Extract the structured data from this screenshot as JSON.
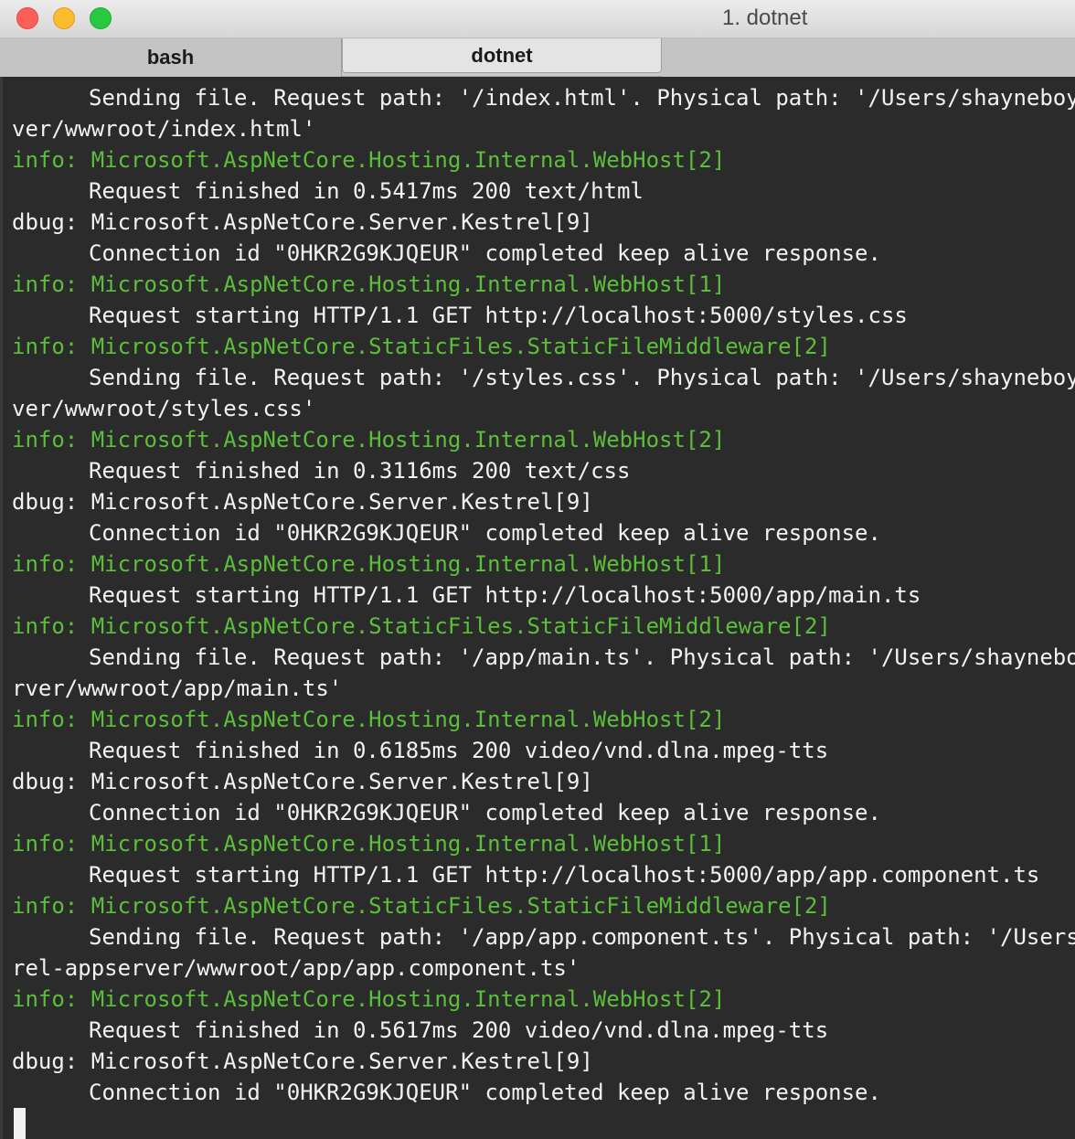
{
  "window": {
    "title": "1. dotnet"
  },
  "tabs": [
    {
      "label": "bash",
      "active": false
    },
    {
      "label": "dotnet",
      "active": true
    }
  ],
  "colors": {
    "background": "#2b2b2b",
    "text": "#f2f2f2",
    "info_green": "#5bbf3a"
  },
  "terminal": {
    "lines": [
      {
        "kind": "cont",
        "text": "Sending file. Request path: '/index.html'. Physical path: '/Users/shayneboyer/"
      },
      {
        "kind": "wrap",
        "text": "ver/wwwroot/index.html'"
      },
      {
        "kind": "log",
        "level": "info:",
        "category": "Microsoft.AspNetCore.Hosting.Internal.WebHost[2]"
      },
      {
        "kind": "cont",
        "text": "Request finished in 0.5417ms 200 text/html"
      },
      {
        "kind": "log",
        "level": "dbug:",
        "category": "Microsoft.AspNetCore.Server.Kestrel[9]"
      },
      {
        "kind": "cont",
        "text": "Connection id \"0HKR2G9KJQEUR\" completed keep alive response."
      },
      {
        "kind": "log",
        "level": "info:",
        "category": "Microsoft.AspNetCore.Hosting.Internal.WebHost[1]"
      },
      {
        "kind": "cont",
        "text": "Request starting HTTP/1.1 GET http://localhost:5000/styles.css"
      },
      {
        "kind": "log",
        "level": "info:",
        "category": "Microsoft.AspNetCore.StaticFiles.StaticFileMiddleware[2]"
      },
      {
        "kind": "cont",
        "text": "Sending file. Request path: '/styles.css'. Physical path: '/Users/shayneboyer/"
      },
      {
        "kind": "wrap",
        "text": "ver/wwwroot/styles.css'"
      },
      {
        "kind": "log",
        "level": "info:",
        "category": "Microsoft.AspNetCore.Hosting.Internal.WebHost[2]"
      },
      {
        "kind": "cont",
        "text": "Request finished in 0.3116ms 200 text/css"
      },
      {
        "kind": "log",
        "level": "dbug:",
        "category": "Microsoft.AspNetCore.Server.Kestrel[9]"
      },
      {
        "kind": "cont",
        "text": "Connection id \"0HKR2G9KJQEUR\" completed keep alive response."
      },
      {
        "kind": "log",
        "level": "info:",
        "category": "Microsoft.AspNetCore.Hosting.Internal.WebHost[1]"
      },
      {
        "kind": "cont",
        "text": "Request starting HTTP/1.1 GET http://localhost:5000/app/main.ts"
      },
      {
        "kind": "log",
        "level": "info:",
        "category": "Microsoft.AspNetCore.StaticFiles.StaticFileMiddleware[2]"
      },
      {
        "kind": "cont",
        "text": "Sending file. Request path: '/app/main.ts'. Physical path: '/Users/shayneboye"
      },
      {
        "kind": "wrap",
        "text": "rver/wwwroot/app/main.ts'"
      },
      {
        "kind": "log",
        "level": "info:",
        "category": "Microsoft.AspNetCore.Hosting.Internal.WebHost[2]"
      },
      {
        "kind": "cont",
        "text": "Request finished in 0.6185ms 200 video/vnd.dlna.mpeg-tts"
      },
      {
        "kind": "log",
        "level": "dbug:",
        "category": "Microsoft.AspNetCore.Server.Kestrel[9]"
      },
      {
        "kind": "cont",
        "text": "Connection id \"0HKR2G9KJQEUR\" completed keep alive response."
      },
      {
        "kind": "log",
        "level": "info:",
        "category": "Microsoft.AspNetCore.Hosting.Internal.WebHost[1]"
      },
      {
        "kind": "cont",
        "text": "Request starting HTTP/1.1 GET http://localhost:5000/app/app.component.ts"
      },
      {
        "kind": "log",
        "level": "info:",
        "category": "Microsoft.AspNetCore.StaticFiles.StaticFileMiddleware[2]"
      },
      {
        "kind": "cont",
        "text": "Sending file. Request path: '/app/app.component.ts'. Physical path: '/Users/s"
      },
      {
        "kind": "wrap",
        "text": "rel-appserver/wwwroot/app/app.component.ts'"
      },
      {
        "kind": "log",
        "level": "info:",
        "category": "Microsoft.AspNetCore.Hosting.Internal.WebHost[2]"
      },
      {
        "kind": "cont",
        "text": "Request finished in 0.5617ms 200 video/vnd.dlna.mpeg-tts"
      },
      {
        "kind": "log",
        "level": "dbug:",
        "category": "Microsoft.AspNetCore.Server.Kestrel[9]"
      },
      {
        "kind": "cont",
        "text": "Connection id \"0HKR2G9KJQEUR\" completed keep alive response."
      }
    ]
  }
}
